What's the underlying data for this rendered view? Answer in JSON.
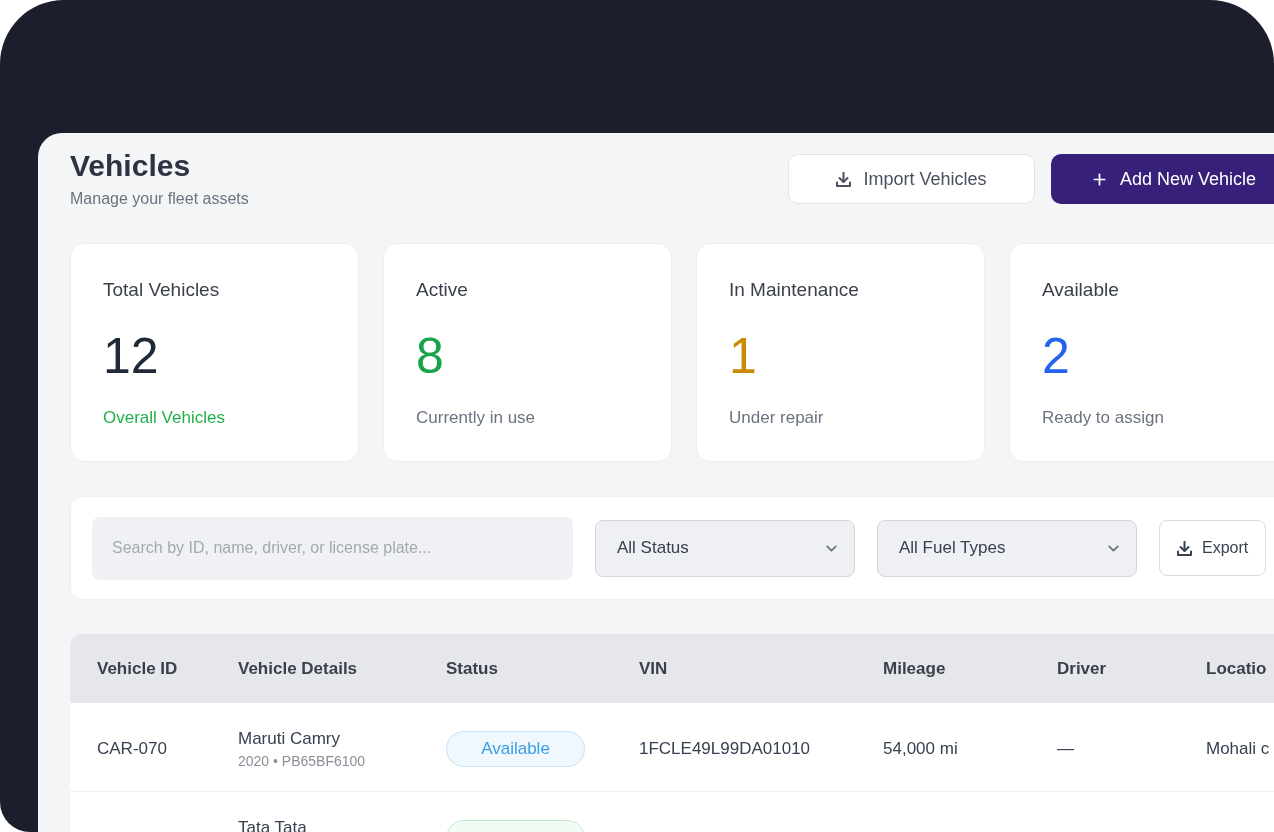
{
  "page": {
    "title": "Vehicles",
    "subtitle": "Manage your fleet assets"
  },
  "actions": [
    {
      "label": "Import Vehicles",
      "kind": "secondary"
    },
    {
      "label": "Add New Vehicle",
      "kind": "primary"
    }
  ],
  "stats": [
    {
      "title": "Total Vehicles",
      "value": "12",
      "color": "#1f2937",
      "note": "Overall Vehicles",
      "note_highlighted": true
    },
    {
      "title": "Active",
      "value": "8",
      "color": "#16a34a",
      "note": "Currently in use",
      "note_highlighted": false
    },
    {
      "title": "In Maintenance",
      "value": "1",
      "color": "#ca8a04",
      "note": "Under repair",
      "note_highlighted": false
    },
    {
      "title": "Available",
      "value": "2",
      "color": "#2563eb",
      "note": "Ready to assign",
      "note_highlighted": false
    }
  ],
  "filters": {
    "search": {
      "placeholder": "Search by ID, name, driver, or license plate..."
    },
    "selects": [
      {
        "value": "All Status"
      },
      {
        "value": "All Fuel Types"
      }
    ],
    "export": {
      "label": "Export"
    }
  },
  "table": {
    "columns": [
      "Vehicle ID",
      "Vehicle Details",
      "Status",
      "VIN",
      "Mileage",
      "Driver",
      "Locatio"
    ],
    "rows": [
      {
        "id": "CAR-070",
        "name": "Maruti Camry",
        "meta": "2020 • PB65BF6100",
        "status": {
          "label": "Available",
          "color": "#3a9fe6"
        },
        "vin": "1FCLE49L99DA01010",
        "mileage": "54,000 mi",
        "driver": "—",
        "location": "Mohali c"
      },
      {
        "name": "Tata Tata",
        "status": {
          "color": "#c2e9cf"
        }
      }
    ]
  }
}
